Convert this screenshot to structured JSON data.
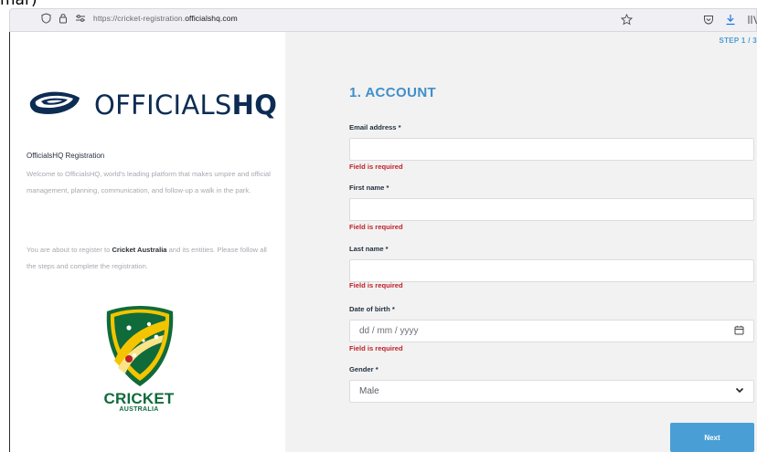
{
  "browser": {
    "url_prefix": "https://cricket-registration.",
    "url_domain": "officialshq.com"
  },
  "left": {
    "logo_light": "OFFICIALS",
    "logo_bold": "HQ",
    "title": "OfficialsHQ Registration",
    "description": "Welcome to OfficialsHQ, world's leading platform that makes umpire and official management, planning, communication, and follow-up a walk in the park.",
    "note_prefix": "You are about to register to ",
    "note_org": "Cricket Australia",
    "note_suffix": " and its entities. Please follow all the steps and complete the registration.",
    "partner_name": "CRICKET",
    "partner_sub": "AUSTRALIA"
  },
  "form": {
    "step": "STEP 1 / 3",
    "section_title": "1. ACCOUNT",
    "fields": [
      {
        "label": "Email address *",
        "value": "",
        "error": "Field is required"
      },
      {
        "label": "First name *",
        "value": "",
        "error": "Field is required"
      },
      {
        "label": "Last name *",
        "value": "",
        "error": "Field is required"
      },
      {
        "label": "Date of birth *",
        "placeholder": "dd / mm / yyyy",
        "error": "Field is required"
      },
      {
        "label": "Gender *",
        "selected": "Male"
      }
    ],
    "next_label": "Next"
  },
  "colors": {
    "accent": "#4a9ed6",
    "error": "#c0212a",
    "brand_navy": "#0d2c54",
    "ca_green": "#0f6b3a",
    "ca_gold": "#f5c400"
  },
  "icons": [
    "shield-icon",
    "lock-icon",
    "permissions-icon",
    "star-icon",
    "pocket-icon",
    "download-icon",
    "library-icon",
    "calendar-icon",
    "chevron-down-icon"
  ]
}
